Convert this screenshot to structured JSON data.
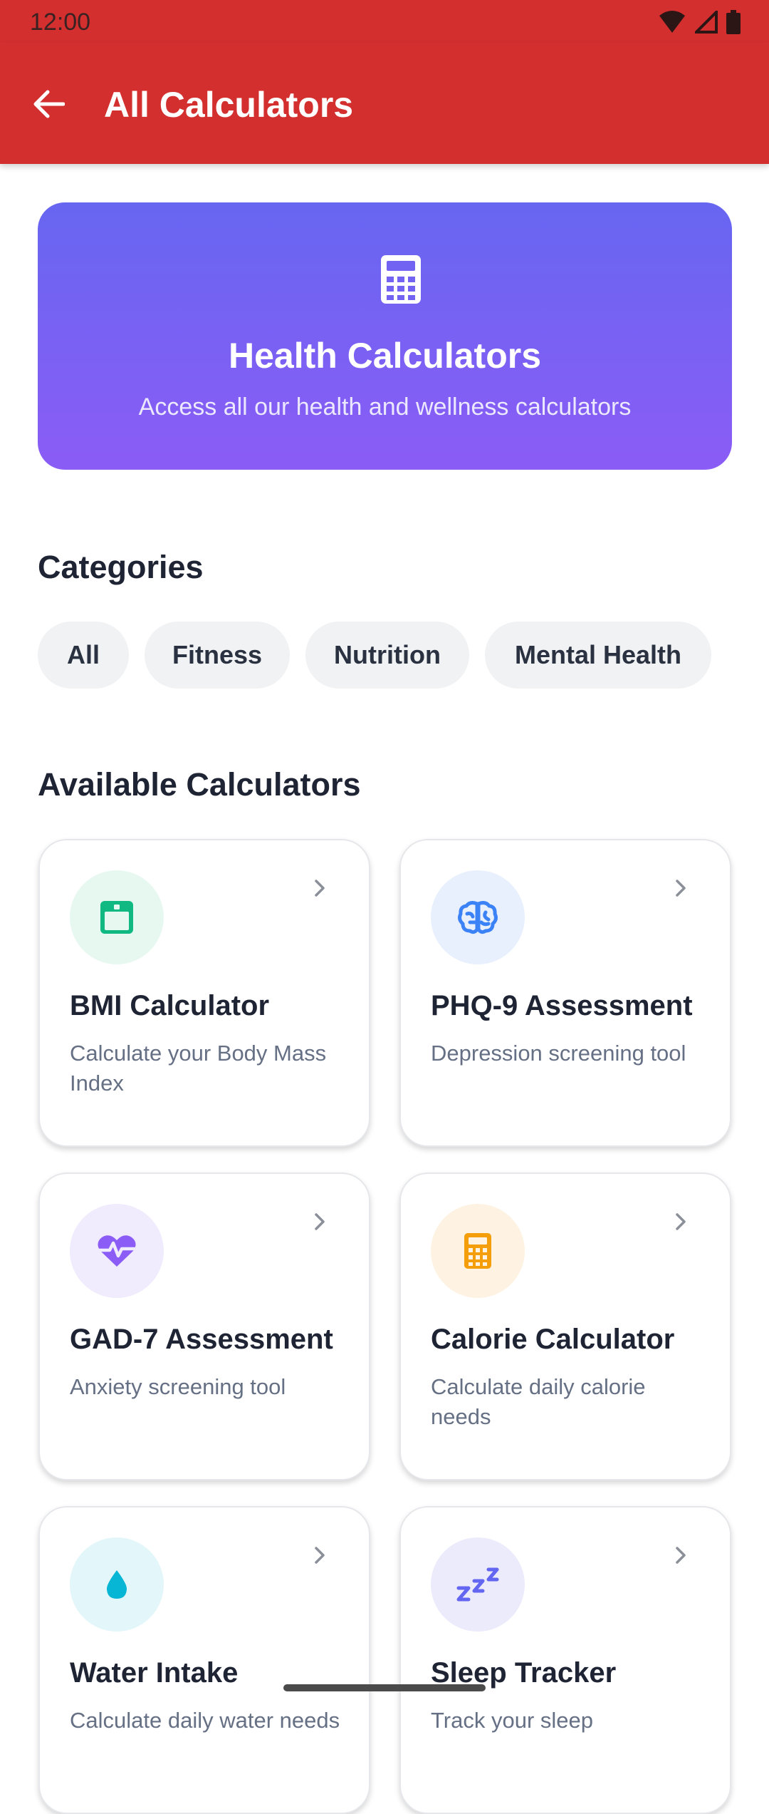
{
  "status_bar": {
    "time": "12:00"
  },
  "app_bar": {
    "title": "All Calculators"
  },
  "hero": {
    "title": "Health Calculators",
    "subtitle": "Access all our health and wellness calculators",
    "icon": "calculator-icon"
  },
  "categories": {
    "heading": "Categories",
    "chips": [
      "All",
      "Fitness",
      "Nutrition",
      "Mental Health"
    ]
  },
  "calculators": {
    "heading": "Available Calculators",
    "items": [
      {
        "title": "BMI Calculator",
        "description": "Calculate your Body Mass Index",
        "icon": "weight-scale-icon",
        "icon_color": "#10b981",
        "bg_color": "#e7f8f1"
      },
      {
        "title": "PHQ-9 Assessment",
        "description": "Depression screening tool",
        "icon": "brain-icon",
        "icon_color": "#3b82f6",
        "bg_color": "#e8f0fe"
      },
      {
        "title": "GAD-7 Assessment",
        "description": "Anxiety screening tool",
        "icon": "heart-pulse-icon",
        "icon_color": "#8b5cf6",
        "bg_color": "#f0ebfd"
      },
      {
        "title": "Calorie Calculator",
        "description": "Calculate daily calorie needs",
        "icon": "calculator-icon",
        "icon_color": "#f59e0b",
        "bg_color": "#fef3e2"
      },
      {
        "title": "Water Intake",
        "description": "Calculate daily water needs",
        "icon": "water-drop-icon",
        "icon_color": "#06b6d4",
        "bg_color": "#e3f6f9"
      },
      {
        "title": "Sleep Tracker",
        "description": "Track your sleep",
        "icon": "sleep-zzz-icon",
        "icon_color": "#6366f1",
        "bg_color": "#ecebfc"
      }
    ]
  },
  "colors": {
    "app_bar": "#d32f2f",
    "hero_start": "#6766f1",
    "hero_end": "#8b5cf6"
  }
}
